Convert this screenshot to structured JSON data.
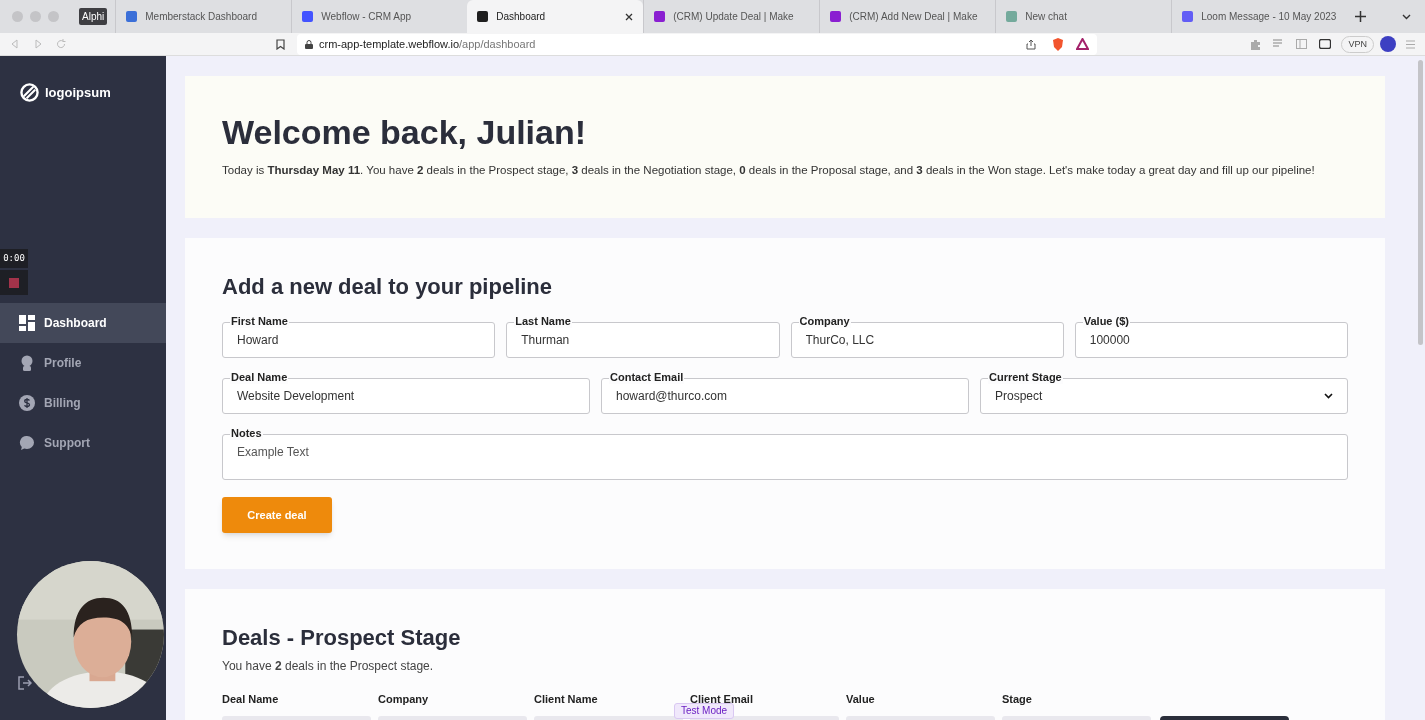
{
  "browser": {
    "profile_badge": "Alphi",
    "tabs": [
      {
        "label": "Memberstack Dashboard",
        "selected": false,
        "color": "#3b6fd8"
      },
      {
        "label": "Webflow - CRM App",
        "selected": false,
        "color": "#4353ff"
      },
      {
        "label": "Dashboard",
        "selected": true,
        "color": "#1f1f1f"
      },
      {
        "label": "(CRM) Update Deal | Make",
        "selected": false,
        "color": "#8a1fd1"
      },
      {
        "label": "(CRM) Add New Deal | Make",
        "selected": false,
        "color": "#8a1fd1"
      },
      {
        "label": "New chat",
        "selected": false,
        "color": "#74aa9c"
      },
      {
        "label": "Loom Message - 10 May 2023",
        "selected": false,
        "color": "#625df5"
      }
    ],
    "url_host": "crm-app-template.webflow.io",
    "url_path": "/app/dashboard",
    "vpn": "VPN"
  },
  "sidebar": {
    "logo": "logoipsum",
    "timer": "0:00",
    "items": [
      {
        "label": "Dashboard",
        "selected": true,
        "kind": "grid"
      },
      {
        "label": "Profile",
        "selected": false,
        "kind": "person"
      },
      {
        "label": "Billing",
        "selected": false,
        "kind": "dollar"
      },
      {
        "label": "Support",
        "selected": false,
        "kind": "chat"
      }
    ]
  },
  "welcome": {
    "title": "Welcome back, Julian!",
    "text": "Today is **Thursday May 11**. You have **2** deals in the Prospect stage, **3** deals in the Negotiation stage, **0** deals in the Proposal stage, and **3** deals in the Won stage. Let's make today a great day and fill up our pipeline!"
  },
  "form": {
    "title": "Add a new deal to your pipeline",
    "rows": [
      [
        {
          "label": "First Name",
          "value": "Howard",
          "kind": "text"
        },
        {
          "label": "Last Name",
          "value": "Thurman",
          "kind": "text"
        },
        {
          "label": "Company",
          "value": "ThurCo, LLC",
          "kind": "text"
        },
        {
          "label": "Value ($)",
          "value": "100000",
          "kind": "text"
        }
      ],
      [
        {
          "label": "Deal Name",
          "value": "Website Development",
          "kind": "text"
        },
        {
          "label": "Contact Email",
          "value": "howard@thurco.com",
          "kind": "text"
        },
        {
          "label": "Current Stage",
          "value": "Prospect",
          "kind": "select"
        }
      ],
      [
        {
          "label": "Notes",
          "placeholder": "Example Text",
          "kind": "textarea"
        }
      ]
    ],
    "button": "Create deal"
  },
  "deals": {
    "title": "Deals - Prospect Stage",
    "summary": "You have **2** deals in the Prospect stage.",
    "columns": [
      "Deal Name",
      "Company",
      "Client Name",
      "Client Email",
      "Value",
      "Stage"
    ],
    "badge": "Test Mode"
  }
}
